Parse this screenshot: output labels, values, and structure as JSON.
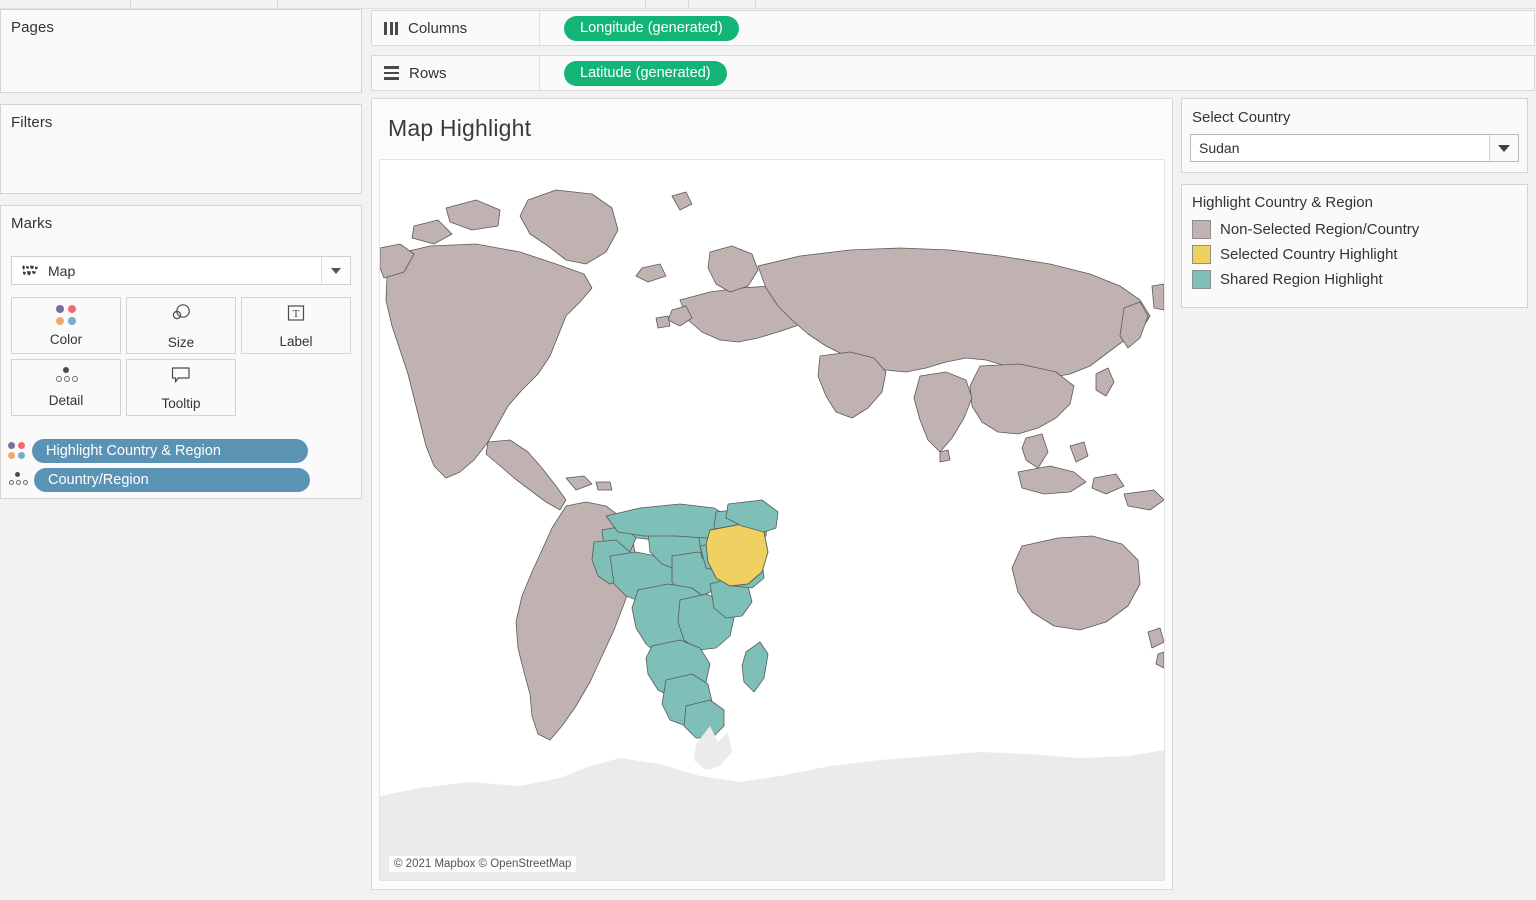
{
  "app": {
    "toolbar_dividers": [
      130,
      277,
      645,
      688,
      755
    ]
  },
  "left_panel": {
    "pages": {
      "title": "Pages"
    },
    "filters": {
      "title": "Filters"
    },
    "marks": {
      "title": "Marks",
      "mark_type": "Map",
      "mark_type_icon": "world-map-icon",
      "buttons": [
        {
          "label": "Color",
          "icon": "color-dots-icon"
        },
        {
          "label": "Size",
          "icon": "size-circles-icon"
        },
        {
          "label": "Label",
          "icon": "label-t-icon"
        },
        {
          "label": "Detail",
          "icon": "detail-dots-icon"
        },
        {
          "label": "Tooltip",
          "icon": "tooltip-bubble-icon"
        }
      ],
      "pills": [
        {
          "label": "Highlight Country & Region",
          "icon": "color-dots-icon"
        },
        {
          "label": "Country/Region",
          "icon": "detail-dots-icon"
        }
      ],
      "pill_color": "#5b93b5"
    }
  },
  "shelves": {
    "columns": {
      "label": "Columns",
      "icon": "columns-bars-icon",
      "pill": "Longitude (generated)"
    },
    "rows": {
      "label": "Rows",
      "icon": "rows-lines-icon",
      "pill": "Latitude (generated)"
    },
    "pill_color": "#12b576"
  },
  "view": {
    "title": "Map Highlight",
    "attribution": "© 2021 Mapbox © OpenStreetMap"
  },
  "right_panel": {
    "filter": {
      "label": "Select Country",
      "selected": "Sudan",
      "placeholder": "Select Country"
    },
    "legend": {
      "title": "Highlight Country & Region",
      "items": [
        {
          "label": "Non-Selected Region/Country",
          "color": "#c0b2b0"
        },
        {
          "label": "Selected Country Highlight",
          "color": "#efd061"
        },
        {
          "label": "Shared Region Highlight",
          "color": "#7ebfb7"
        }
      ]
    }
  },
  "chart_data": {
    "type": "map",
    "title": "Map Highlight",
    "projection": "web-mercator-world",
    "selected_country": "Sudan",
    "selected_region": "Africa",
    "colors": {
      "non_selected": "#c0b2b0",
      "selected_country": "#efd061",
      "shared_region": "#7ebfb7",
      "antarctica": "#ebebeb",
      "ocean": "#ffffff",
      "border": "#5a5a5a"
    },
    "legend_position": "right",
    "attribution": "© 2021 Mapbox © OpenStreetMap"
  }
}
